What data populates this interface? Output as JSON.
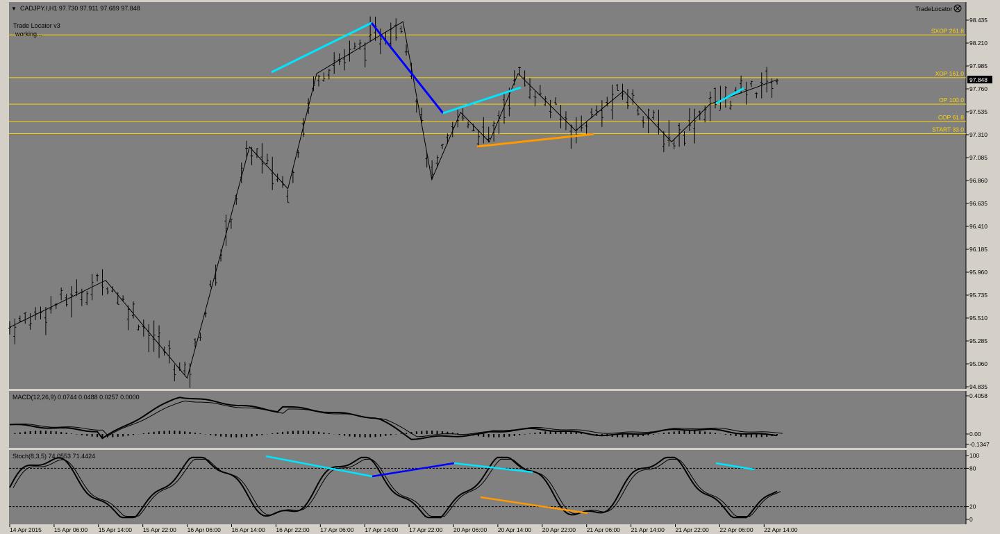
{
  "header": {
    "symbol_line": "CADJPY.I,H1  97.730 97.911 97.689 97.848",
    "indicator_name": "Trade Locator v3",
    "indicator_status": "working...",
    "brand": "TradeLocator"
  },
  "colors": {
    "background": "#808080",
    "bar": "#000000",
    "level": "#ffd700",
    "cyan": "#00e5ff",
    "blue": "#0000ff",
    "orange": "#ff9900"
  },
  "price_axis": {
    "ticks": [
      "98.435",
      "98.210",
      "97.985",
      "97.760",
      "97.535",
      "97.310",
      "97.085",
      "96.860",
      "96.635",
      "96.410",
      "96.185",
      "95.960",
      "95.735",
      "95.510",
      "95.285",
      "95.060",
      "94.835"
    ],
    "current_price": "97.848"
  },
  "levels": [
    {
      "name": "sxop",
      "label": "SXOP 261.8",
      "price": 98.29
    },
    {
      "name": "xop",
      "label": "XOP 161.0",
      "price": 97.87
    },
    {
      "name": "op",
      "label": "OP 100.0",
      "price": 97.61
    },
    {
      "name": "cop",
      "label": "COP 61.8",
      "price": 97.44
    },
    {
      "name": "start",
      "label": "START 33.0",
      "price": 97.32
    }
  ],
  "time_axis": [
    "14 Apr 2015",
    "15 Apr 06:00",
    "15 Apr 14:00",
    "15 Apr 22:00",
    "16 Apr 06:00",
    "16 Apr 14:00",
    "16 Apr 22:00",
    "17 Apr 06:00",
    "17 Apr 14:00",
    "17 Apr 22:00",
    "20 Apr 06:00",
    "20 Apr 14:00",
    "20 Apr 22:00",
    "21 Apr 06:00",
    "21 Apr 14:00",
    "21 Apr 22:00",
    "22 Apr 06:00",
    "22 Apr 14:00"
  ],
  "macd": {
    "label": "MACD(12,26,9) 0.0744 0.0488 0.0257 0.0000",
    "ticks": [
      "0.4058",
      "0.00",
      "-0.1347"
    ]
  },
  "stoch": {
    "label": "Stoch(8,3,5) 74.0553 71.4424",
    "ticks": [
      "100",
      "80",
      "20",
      "0"
    ]
  },
  "chart_data": {
    "type": "line",
    "title": "CADJPY.I,H1",
    "price_zigzag": [
      {
        "t": "14 Apr 2015",
        "price": 95.42
      },
      {
        "t": "14 Apr 20:00",
        "price": 95.88
      },
      {
        "t": "15 Apr 13:00",
        "price": 94.92
      },
      {
        "t": "16 Apr 02:00",
        "price": 97.19
      },
      {
        "t": "16 Apr 10:00",
        "price": 96.78
      },
      {
        "t": "16 Apr 16:00",
        "price": 97.91
      },
      {
        "t": "17 Apr 10:00",
        "price": 98.42
      },
      {
        "t": "17 Apr 16:00",
        "price": 96.87
      },
      {
        "t": "17 Apr 22:00",
        "price": 97.53
      },
      {
        "t": "20 Apr 04:00",
        "price": 97.24
      },
      {
        "t": "20 Apr 10:00",
        "price": 97.91
      },
      {
        "t": "20 Apr 22:00",
        "price": 97.35
      },
      {
        "t": "21 Apr 08:00",
        "price": 97.74
      },
      {
        "t": "21 Apr 18:00",
        "price": 97.24
      },
      {
        "t": "22 Apr 02:00",
        "price": 97.61
      },
      {
        "t": "22 Apr 16:00",
        "price": 97.85
      }
    ]
  }
}
